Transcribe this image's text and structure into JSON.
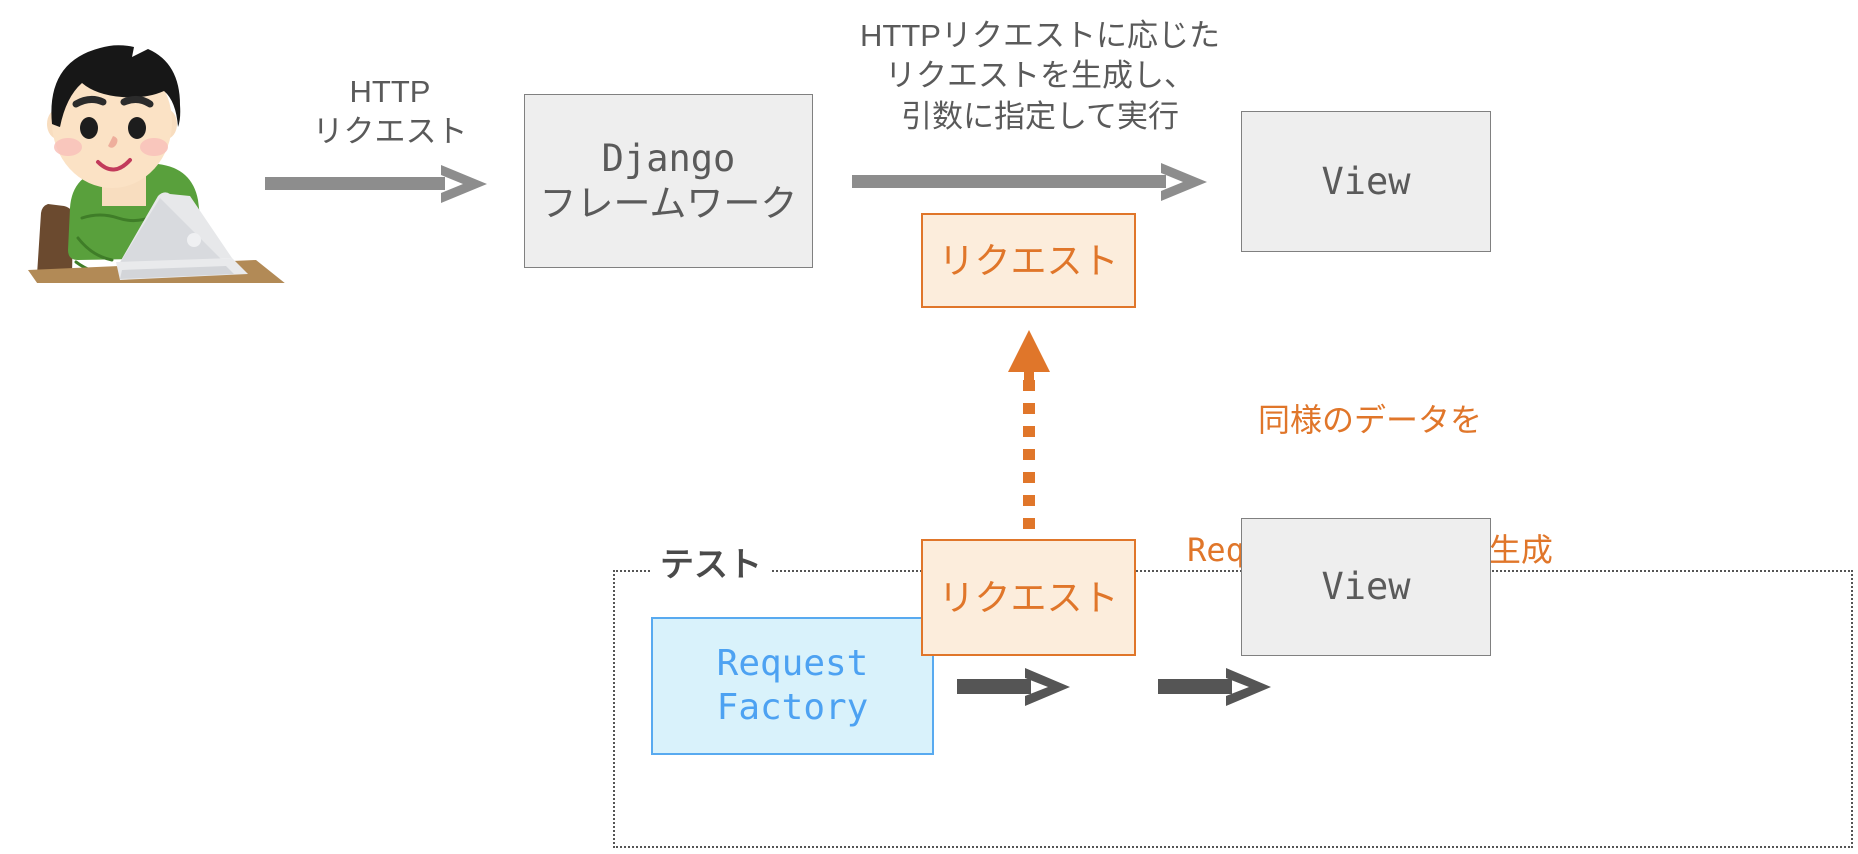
{
  "diagram": {
    "title_text_top": "HTTPリクエストに応じた\nリクエストを生成し、\n引数に指定して実行",
    "http_request_label": "HTTP\nリクエスト",
    "same_data_label": "同様のデータを",
    "request_factory_generates_prefix": "RequestFactory",
    "request_factory_generates_suffix": "が生成",
    "test_frame_label": "テスト"
  },
  "boxes": {
    "django": {
      "line1": "Django",
      "line2": "フレームワーク"
    },
    "view_top": {
      "label": "View"
    },
    "request_top": {
      "label": "リクエスト"
    },
    "request_factory": {
      "line1": "Request",
      "line2": "Factory"
    },
    "request_bottom": {
      "label": "リクエスト"
    },
    "view_bottom": {
      "label": "View"
    }
  },
  "icons": {
    "person_with_laptop": "person-laptop-illustration",
    "arrow_right_1": "arrow-right-icon",
    "arrow_right_2": "arrow-right-icon",
    "arrow_right_3": "arrow-right-icon",
    "arrow_right_4": "arrow-right-icon",
    "arrow_up_dotted": "arrow-up-dotted-icon"
  },
  "colors": {
    "gray_box_fill": "#eeeeee",
    "gray_box_border": "#808080",
    "gray_text": "#5a5a5a",
    "orange_fill": "#fceddc",
    "orange_border": "#e0762a",
    "orange_text": "#e0762a",
    "blue_fill": "#d9f2fb",
    "blue_border": "#58aaf0",
    "blue_text": "#4da2f2",
    "arrow_gray_light": "#8d8d8d",
    "arrow_gray_dark": "#555555",
    "dotted_frame": "#555555",
    "shirt_green": "#5a9e3a",
    "hair_black": "#1a1a1a",
    "skin": "#fbdfc3",
    "desk_brown": "#b08a52",
    "laptop_silver": "#dcdde0"
  }
}
